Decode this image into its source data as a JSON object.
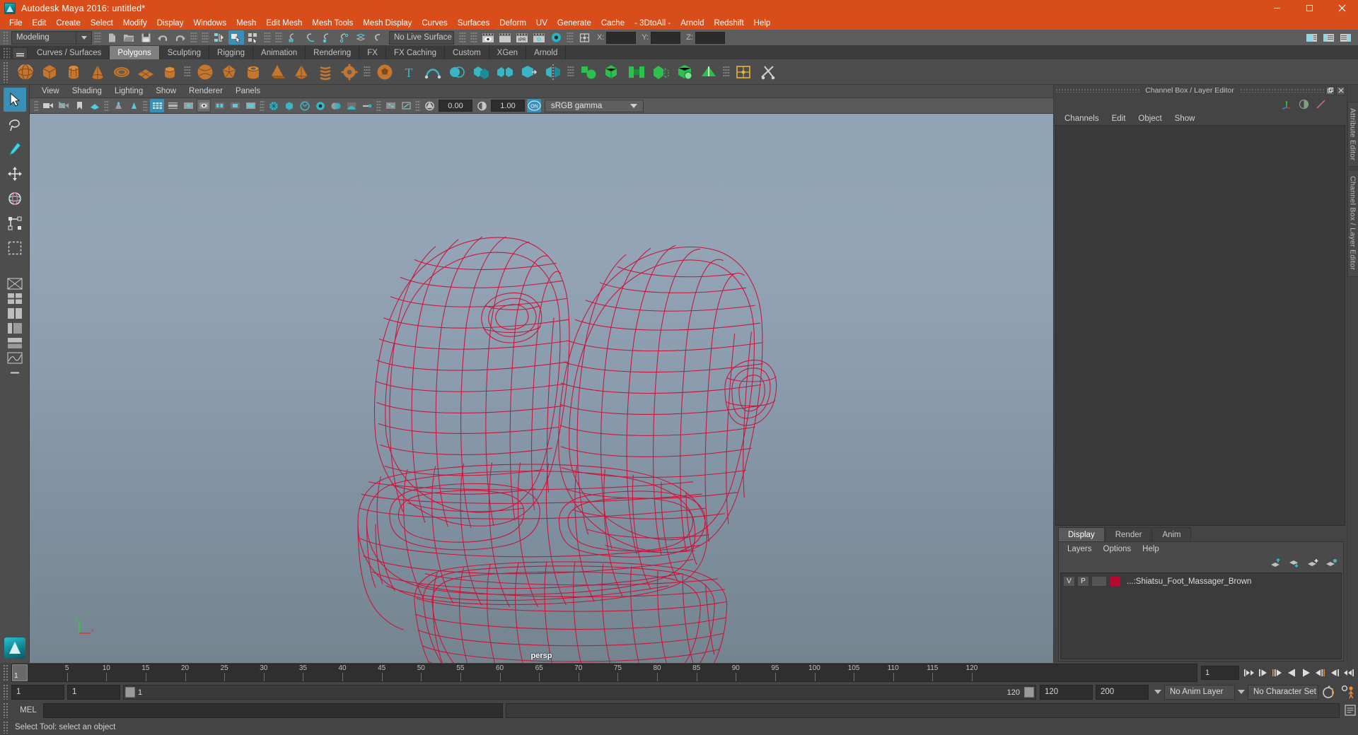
{
  "window": {
    "title": "Autodesk Maya 2016: untitled*",
    "logo_icon": "maya-logo-icon",
    "minimize_icon": "minimize-icon",
    "maximize_icon": "maximize-icon",
    "close_icon": "close-icon",
    "titlebar_color": "#d94d1a"
  },
  "menubar": {
    "items": [
      "File",
      "Edit",
      "Create",
      "Select",
      "Modify",
      "Display",
      "Windows",
      "Mesh",
      "Edit Mesh",
      "Mesh Tools",
      "Mesh Display",
      "Curves",
      "Surfaces",
      "Deform",
      "UV",
      "Generate",
      "Cache",
      "- 3DtoAll -",
      "Arnold",
      "Redshift",
      "Help"
    ]
  },
  "statusbar": {
    "menu_set": "Modeling",
    "live_surface": "No Live Surface",
    "coord_labels": [
      "X:",
      "Y:",
      "Z:"
    ],
    "coord_values": [
      "",
      "",
      ""
    ],
    "icons": [
      "new-scene-icon",
      "open-scene-icon",
      "save-scene-icon",
      "undo-icon",
      "redo-icon",
      "select-by-hierarchy-icon",
      "select-by-object-icon",
      "select-by-component-icon",
      "snap-to-grid-icon",
      "snap-to-curve-icon",
      "snap-to-point-icon",
      "snap-to-projected-center-icon",
      "snap-to-view-plane-icon",
      "make-live-icon",
      "render-view-icon",
      "render-sequence-icon",
      "ipr-render-icon",
      "render-settings-icon",
      "hypershade-icon",
      "input-output-connections-icon",
      "show-attribute-editor-icon",
      "show-tool-settings-icon",
      "show-channel-box-icon"
    ]
  },
  "shelf": {
    "tabs": [
      "Curves / Surfaces",
      "Polygons",
      "Sculpting",
      "Rigging",
      "Animation",
      "Rendering",
      "FX",
      "FX Caching",
      "Custom",
      "XGen",
      "Arnold"
    ],
    "active_tab": "Polygons",
    "menu_icon": "shelf-menu-icon",
    "icons": [
      "poly-sphere-icon",
      "poly-cube-icon",
      "poly-cylinder-icon",
      "poly-cone-icon",
      "poly-torus-icon",
      "poly-plane-icon",
      "poly-disc-icon",
      "poly-sphere-smooth-icon",
      "poly-platonic-icon",
      "poly-pipe-icon",
      "poly-prism-icon",
      "poly-pyramid-icon",
      "poly-helix-icon",
      "poly-gear-icon",
      "poly-soccerball-icon",
      "poly-type-icon",
      "poly-svg-icon",
      "poly-boolean-icon",
      "poly-combine-icon",
      "poly-separate-icon",
      "poly-extract-icon",
      "poly-mirror-icon",
      "poly-smooth-icon",
      "poly-reduce-icon",
      "poly-bridge-icon",
      "poly-append-icon",
      "poly-booleans-icon",
      "poly-crease-icon",
      "poly-multicut-icon"
    ]
  },
  "toolbox": {
    "items": [
      {
        "name": "select-tool",
        "icon": "arrow-cursor-icon",
        "selected": true
      },
      {
        "name": "lasso-tool",
        "icon": "lasso-icon",
        "selected": false
      },
      {
        "name": "paint-select-tool",
        "icon": "paint-brush-icon",
        "selected": false
      },
      {
        "name": "move-tool",
        "icon": "move-arrows-icon",
        "selected": false
      },
      {
        "name": "rotate-tool",
        "icon": "rotate-circle-icon",
        "selected": false
      },
      {
        "name": "scale-tool",
        "icon": "scale-box-icon",
        "selected": false
      },
      {
        "name": "last-tool",
        "icon": "last-tool-icon",
        "selected": false
      }
    ],
    "layout_presets": [
      "single-perspective-layout",
      "four-view-layout",
      "two-pane-side-layout",
      "outliner-persp-layout",
      "hypershade-persp-layout",
      "graph-editor-layout"
    ],
    "maya_badge_icon": "maya-logo-icon"
  },
  "viewport": {
    "menus": [
      "View",
      "Shading",
      "Lighting",
      "Show",
      "Renderer",
      "Panels"
    ],
    "camera_label": "persp",
    "exposure_value": "0.00",
    "gamma_value": "1.00",
    "color_management": "sRGB gamma",
    "color_mgmt_toggle": "ON",
    "toolbar_icons": [
      "select-camera-icon",
      "camera-attributes-icon",
      "bookmark-icon",
      "image-plane-icon",
      "two-pane-icon",
      "grid-toggle-icon",
      "film-gate-icon",
      "resolution-gate-icon",
      "gate-mask-icon",
      "xray-icon",
      "xray-joints-icon",
      "exposure-icon",
      "gamma-icon",
      "wireframe-on-shaded-icon",
      "smooth-shade-icon",
      "flat-shade-icon",
      "textured-icon",
      "use-all-lights-icon",
      "shadows-icon",
      "screen-space-ao-icon",
      "motion-blur-icon",
      "multisample-icon",
      "isolate-select-icon",
      "xray-mode-icon",
      "color-management-toggle-icon"
    ],
    "axis_labels": [
      "y",
      "x"
    ],
    "model_name": "Shiatsu Foot Massager wireframe",
    "wireframe_color": "#cc1035",
    "bg_top_color": "#8fa3b5",
    "bg_bottom_color": "#74848f"
  },
  "channel_box": {
    "panel_title": "Channel Box / Layer Editor",
    "menus": [
      "Channels",
      "Edit",
      "Object",
      "Show"
    ],
    "float_icon": "undock-icon",
    "close_icon": "close-icon",
    "header_icons": [
      "axis-gizmo-icon",
      "half-circle-icon",
      "diagonal-slash-icon"
    ],
    "content": ""
  },
  "layer_editor": {
    "tabs": [
      "Display",
      "Render",
      "Anim"
    ],
    "active_tab": "Display",
    "menus": [
      "Layers",
      "Options",
      "Help"
    ],
    "tool_icons": [
      "move-layer-up-icon",
      "move-layer-down-icon",
      "new-layer-icon",
      "new-layer-from-selection-icon"
    ],
    "layers": [
      {
        "visibility": "V",
        "playback": "P",
        "blank": "",
        "color": "#b8082e",
        "name": "...:Shiatsu_Foot_Massager_Brown"
      }
    ]
  },
  "side_tabs": [
    "Attribute Editor",
    "Channel Box / Layer Editor"
  ],
  "time_slider": {
    "current_frame": "1",
    "start_label": "1",
    "tick_labels": [
      "5",
      "10",
      "15",
      "20",
      "25",
      "30",
      "35",
      "40",
      "45",
      "50",
      "55",
      "60",
      "65",
      "70",
      "75",
      "80",
      "85",
      "90",
      "95",
      "100",
      "105",
      "110",
      "115",
      "120"
    ],
    "current_frame_field": "1",
    "playback_buttons": [
      "go-to-start-icon",
      "step-back-keyframe-icon",
      "step-back-frame-icon",
      "play-backwards-icon",
      "play-forwards-icon",
      "step-forward-frame-icon",
      "step-forward-keyframe-icon",
      "go-to-end-icon"
    ]
  },
  "range_slider": {
    "anim_start": "1",
    "range_start": "1",
    "range_bar_start": "1",
    "range_bar_end": "120",
    "range_end": "120",
    "anim_end": "200",
    "anim_layer": "No Anim Layer",
    "character_set": "No Character Set",
    "auto_key_icon": "auto-keyframe-icon",
    "anim_prefs_icon": "animation-preferences-icon"
  },
  "command_line": {
    "label": "MEL",
    "input_value": "",
    "output_value": "",
    "script_editor_icon": "script-editor-icon"
  },
  "help_line": {
    "text": "Select Tool: select an object"
  }
}
